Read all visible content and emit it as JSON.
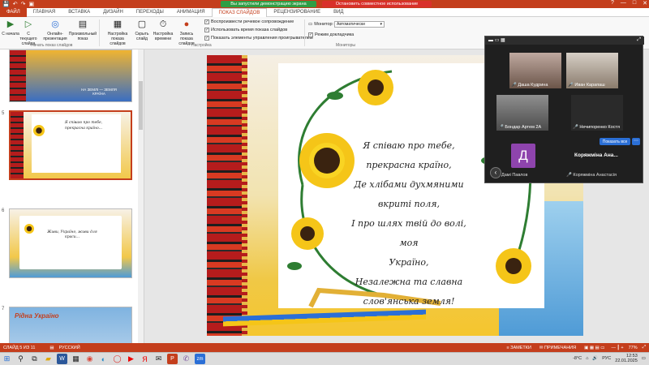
{
  "titlebar": {
    "share_status": "Вы запустили демонстрацию экрана",
    "stop_share": "Остановить совместное использование",
    "window_controls": [
      "?",
      "—",
      "□",
      "✕"
    ]
  },
  "tabs": [
    "ФАЙЛ",
    "ГЛАВНАЯ",
    "ВСТАВКА",
    "ДИЗАЙН",
    "ПЕРЕХОДЫ",
    "АНИМАЦИЯ",
    "ПОКАЗ СЛАЙДОВ",
    "РЕЦЕНЗИРОВАНИЕ",
    "ВИД"
  ],
  "active_tab": "ПОКАЗ СЛАЙДОВ",
  "ribbon": {
    "buttons": [
      {
        "label": "С начала",
        "icon": "play-from-start-icon"
      },
      {
        "label": "С текущего слайда",
        "icon": "play-current-icon"
      },
      {
        "label": "Онлайн-презентация",
        "icon": "online-present-icon"
      },
      {
        "label": "Произвольный показ",
        "icon": "custom-show-icon"
      },
      {
        "label": "Настройка показа слайдов",
        "icon": "setup-show-icon"
      },
      {
        "label": "Скрыть слайд",
        "icon": "hide-slide-icon"
      },
      {
        "label": "Настройка времени",
        "icon": "rehearse-timings-icon"
      },
      {
        "label": "Запись показа слайдов",
        "icon": "record-show-icon"
      }
    ],
    "group_start": "Начать показ слайдов",
    "group_setup": "Настройка",
    "group_monitors": "Мониторы",
    "checks": [
      {
        "label": "Воспроизвести речевое сопровождение",
        "checked": true
      },
      {
        "label": "Использовать время показа слайдов",
        "checked": true
      },
      {
        "label": "Показать элементы управления проигрывателем",
        "checked": true
      }
    ],
    "monitor_label": "Монитор:",
    "monitor_value": "Автоматически",
    "presenter_view": "Режим докладчика"
  },
  "thumbnails": [
    {
      "num": "",
      "caption": "НА ЗЕМЛІ — ЗЕМЛЯ КРАЇНА"
    },
    {
      "num": "5",
      "caption": "Я співаю про тебе, прекрасна країно...",
      "selected": true
    },
    {
      "num": "6",
      "caption": "Живи, Україно, живи для краси..."
    },
    {
      "num": "7",
      "caption": "Рідна Україно"
    }
  ],
  "slide": {
    "poem_lines": [
      "Я співаю про тебе,",
      "прекрасна країно,",
      "Де хлібами духмяними",
      "вкриті поля,",
      "І про шлях твій до волі, моя",
      "Україно,",
      "Незалежна та славна",
      "слов'янська земля!"
    ]
  },
  "call": {
    "participants": [
      {
        "name": "Даша Кудрина"
      },
      {
        "name": "Иван Карапаш"
      },
      {
        "name": "Бондар Артем 2А"
      },
      {
        "name": "Нечипоренко Костя"
      }
    ],
    "show_all": "Показать все",
    "avatar_letter": "Д",
    "big_name": "Коряжміна Ана...",
    "bottom_names": [
      "Дамі Павлов",
      "Коряжміна Анастасія"
    ]
  },
  "status": {
    "slide_info": "СЛАЙД 5 ИЗ 11",
    "language": "РУССКИЙ",
    "notes": "ЗАМЕТКИ",
    "comments": "ПРИМЕЧАНИЯ",
    "zoom": "77%"
  },
  "taskbar": {
    "weather": "-8°C",
    "lang": "РУС",
    "time": "12:53",
    "date": "22.01.2025"
  },
  "colors": {
    "accent": "#c43e1c",
    "share_green": "#2f9e44",
    "stop_red": "#d9302a",
    "zoom_blue": "#2b6fd6"
  }
}
